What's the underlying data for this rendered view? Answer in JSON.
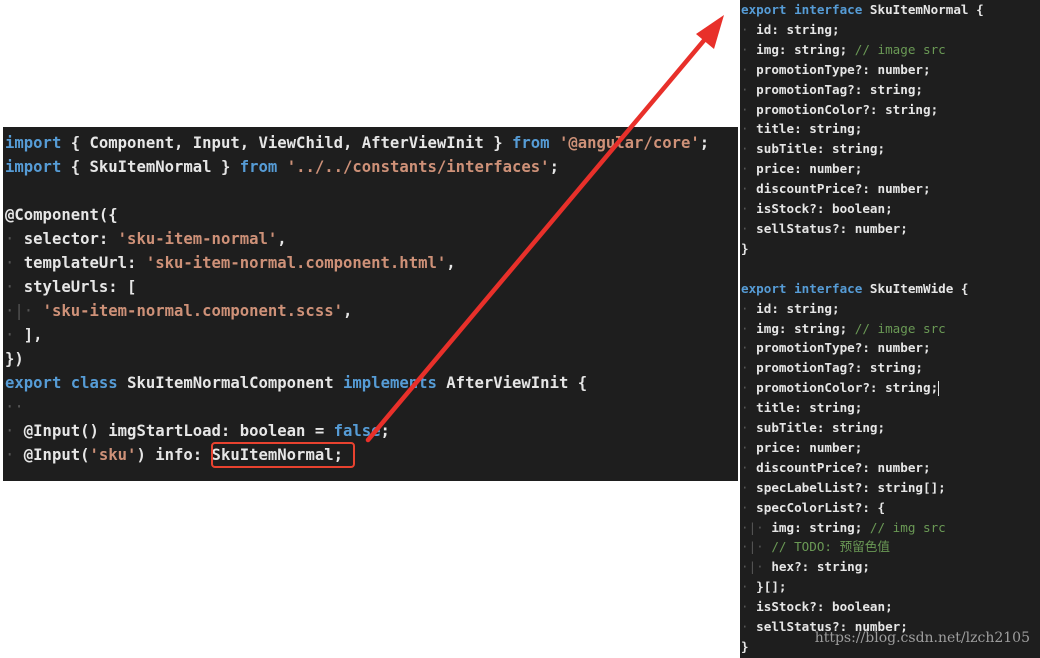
{
  "left_code": {
    "lines": [
      [
        {
          "t": "kw",
          "v": "import"
        },
        {
          "t": "txt",
          "v": " { Component, Input, ViewChild, AfterViewInit } "
        },
        {
          "t": "kw",
          "v": "from"
        },
        {
          "t": "txt",
          "v": " "
        },
        {
          "t": "str",
          "v": "'@angular/core'"
        },
        {
          "t": "txt",
          "v": ";"
        }
      ],
      [
        {
          "t": "kw",
          "v": "import"
        },
        {
          "t": "txt",
          "v": " { SkuItemNormal } "
        },
        {
          "t": "kw",
          "v": "from"
        },
        {
          "t": "txt",
          "v": " "
        },
        {
          "t": "str",
          "v": "'../../constants/interfaces'"
        },
        {
          "t": "txt",
          "v": ";"
        }
      ],
      [],
      [
        {
          "t": "txt",
          "v": "@Component({"
        }
      ],
      [
        {
          "t": "ws",
          "v": "·"
        },
        {
          "t": "txt",
          "v": " selector: "
        },
        {
          "t": "str",
          "v": "'sku-item-normal'"
        },
        {
          "t": "txt",
          "v": ","
        }
      ],
      [
        {
          "t": "ws",
          "v": "·"
        },
        {
          "t": "txt",
          "v": " templateUrl: "
        },
        {
          "t": "str",
          "v": "'sku-item-normal.component.html'"
        },
        {
          "t": "txt",
          "v": ","
        }
      ],
      [
        {
          "t": "ws",
          "v": "·"
        },
        {
          "t": "txt",
          "v": " styleUrls: ["
        }
      ],
      [
        {
          "t": "ws",
          "v": "·|·"
        },
        {
          "t": "txt",
          "v": " "
        },
        {
          "t": "str",
          "v": "'sku-item-normal.component.scss'"
        },
        {
          "t": "txt",
          "v": ","
        }
      ],
      [
        {
          "t": "ws",
          "v": "·"
        },
        {
          "t": "txt",
          "v": " ],"
        }
      ],
      [
        {
          "t": "txt",
          "v": "})"
        }
      ],
      [
        {
          "t": "kw",
          "v": "export"
        },
        {
          "t": "txt",
          "v": " "
        },
        {
          "t": "kw",
          "v": "class"
        },
        {
          "t": "txt",
          "v": " SkuItemNormalComponent "
        },
        {
          "t": "kw",
          "v": "implements"
        },
        {
          "t": "txt",
          "v": " AfterViewInit {"
        }
      ],
      [
        {
          "t": "ws",
          "v": "··"
        }
      ],
      [
        {
          "t": "ws",
          "v": "·"
        },
        {
          "t": "txt",
          "v": " @Input() imgStartLoad: boolean = "
        },
        {
          "t": "kw",
          "v": "false"
        },
        {
          "t": "txt",
          "v": ";"
        }
      ],
      [
        {
          "t": "ws",
          "v": "·"
        },
        {
          "t": "txt",
          "v": " @Input("
        },
        {
          "t": "str",
          "v": "'sku'"
        },
        {
          "t": "txt",
          "v": ") info: SkuItemNormal;"
        }
      ]
    ]
  },
  "right_code": {
    "lines": [
      [
        {
          "t": "kw",
          "v": "export"
        },
        {
          "t": "txt",
          "v": " "
        },
        {
          "t": "kw",
          "v": "interface"
        },
        {
          "t": "txt",
          "v": " SkuItemNormal {"
        }
      ],
      [
        {
          "t": "ws",
          "v": "·"
        },
        {
          "t": "txt",
          "v": " id: string;"
        }
      ],
      [
        {
          "t": "ws",
          "v": "·"
        },
        {
          "t": "txt",
          "v": " img: string; "
        },
        {
          "t": "cmt",
          "v": "// image src"
        }
      ],
      [
        {
          "t": "ws",
          "v": "·"
        },
        {
          "t": "txt",
          "v": " promotionType?: number;"
        }
      ],
      [
        {
          "t": "ws",
          "v": "·"
        },
        {
          "t": "txt",
          "v": " promotionTag?: string;"
        }
      ],
      [
        {
          "t": "ws",
          "v": "·"
        },
        {
          "t": "txt",
          "v": " promotionColor?: string;"
        }
      ],
      [
        {
          "t": "ws",
          "v": "·"
        },
        {
          "t": "txt",
          "v": " title: string;"
        }
      ],
      [
        {
          "t": "ws",
          "v": "·"
        },
        {
          "t": "txt",
          "v": " subTitle: string;"
        }
      ],
      [
        {
          "t": "ws",
          "v": "·"
        },
        {
          "t": "txt",
          "v": " price: number;"
        }
      ],
      [
        {
          "t": "ws",
          "v": "·"
        },
        {
          "t": "txt",
          "v": " discountPrice?: number;"
        }
      ],
      [
        {
          "t": "ws",
          "v": "·"
        },
        {
          "t": "txt",
          "v": " isStock?: boolean;"
        }
      ],
      [
        {
          "t": "ws",
          "v": "·"
        },
        {
          "t": "txt",
          "v": " sellStatus?: number;"
        }
      ],
      [
        {
          "t": "txt",
          "v": "}"
        }
      ],
      [],
      [
        {
          "t": "kw",
          "v": "export"
        },
        {
          "t": "txt",
          "v": " "
        },
        {
          "t": "kw",
          "v": "interface"
        },
        {
          "t": "txt",
          "v": " SkuItemWide {"
        }
      ],
      [
        {
          "t": "ws",
          "v": "·"
        },
        {
          "t": "txt",
          "v": " id: string;"
        }
      ],
      [
        {
          "t": "ws",
          "v": "·"
        },
        {
          "t": "txt",
          "v": " img: string; "
        },
        {
          "t": "cmt",
          "v": "// image src"
        }
      ],
      [
        {
          "t": "ws",
          "v": "·"
        },
        {
          "t": "txt",
          "v": " promotionType?: number;"
        }
      ],
      [
        {
          "t": "ws",
          "v": "·"
        },
        {
          "t": "txt",
          "v": " promotionTag?: string;"
        }
      ],
      [
        {
          "t": "ws",
          "v": "·"
        },
        {
          "t": "txt",
          "v": " promotionColor?: string;"
        },
        {
          "t": "caret",
          "v": ""
        }
      ],
      [
        {
          "t": "ws",
          "v": "·"
        },
        {
          "t": "txt",
          "v": " title: string;"
        }
      ],
      [
        {
          "t": "ws",
          "v": "·"
        },
        {
          "t": "txt",
          "v": " subTitle: string;"
        }
      ],
      [
        {
          "t": "ws",
          "v": "·"
        },
        {
          "t": "txt",
          "v": " price: number;"
        }
      ],
      [
        {
          "t": "ws",
          "v": "·"
        },
        {
          "t": "txt",
          "v": " discountPrice?: number;"
        }
      ],
      [
        {
          "t": "ws",
          "v": "·"
        },
        {
          "t": "txt",
          "v": " specLabelList?: string[];"
        }
      ],
      [
        {
          "t": "ws",
          "v": "·"
        },
        {
          "t": "txt",
          "v": " specColorList?: {"
        }
      ],
      [
        {
          "t": "ws",
          "v": "·|·"
        },
        {
          "t": "txt",
          "v": " img: string; "
        },
        {
          "t": "cmt",
          "v": "// img src"
        }
      ],
      [
        {
          "t": "ws",
          "v": "·|·"
        },
        {
          "t": "txt",
          "v": " "
        },
        {
          "t": "cmt",
          "v": "// TODO: 预留色值"
        }
      ],
      [
        {
          "t": "ws",
          "v": "·|·"
        },
        {
          "t": "txt",
          "v": " hex?: string;"
        }
      ],
      [
        {
          "t": "ws",
          "v": "·"
        },
        {
          "t": "txt",
          "v": " }[];"
        }
      ],
      [
        {
          "t": "ws",
          "v": "·"
        },
        {
          "t": "txt",
          "v": " isStock?: boolean;"
        }
      ],
      [
        {
          "t": "ws",
          "v": "·"
        },
        {
          "t": "txt",
          "v": " sellStatus?: number;"
        }
      ],
      [
        {
          "t": "txt",
          "v": "}"
        }
      ]
    ]
  },
  "highlight": {
    "text": "SkuItemNormal;",
    "color": "#e8422f"
  },
  "arrow": {
    "color": "#e8302a"
  },
  "watermark": "https://blog.csdn.net/lzch2105",
  "colors": {
    "background": "#1e1e1e",
    "keyword": "#569cd6",
    "string": "#ce9178",
    "comment": "#6a9955",
    "text": "#e6e6e6"
  }
}
